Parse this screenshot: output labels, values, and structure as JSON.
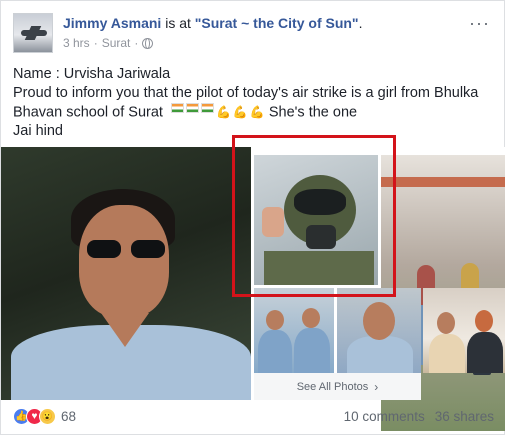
{
  "header": {
    "author": "Jimmy Asmani",
    "connector": "is at",
    "place": "\"Surat ~ the City of Sun\"",
    "period": ".",
    "time": "3 hrs",
    "separator": "·",
    "location": "Surat",
    "separator2": "·",
    "privacy_icon": "globe-icon",
    "more_label": "···"
  },
  "post": {
    "line1": "Name : Urvisha Jariwala",
    "line2": "Proud to inform you that the pilot of today's air strike is a girl from Bhulka",
    "line3_pre": "Bhavan school of Surat",
    "line3_post": "She's the one",
    "line4": "Jai hind",
    "emoji": [
      "indian-flag",
      "indian-flag",
      "indian-flag",
      "flexed-biceps",
      "flexed-biceps",
      "flexed-biceps"
    ]
  },
  "photos": {
    "see_all_label": "See All Photos",
    "highlight_color": "#d3131a"
  },
  "footer": {
    "reaction_icons": [
      "like-icon",
      "love-icon",
      "wow-icon"
    ],
    "reaction_count": "68",
    "comments": "10 comments",
    "shares": "36 shares"
  },
  "colors": {
    "link": "#365899",
    "meta": "#90949c",
    "highlight": "#d3131a"
  }
}
